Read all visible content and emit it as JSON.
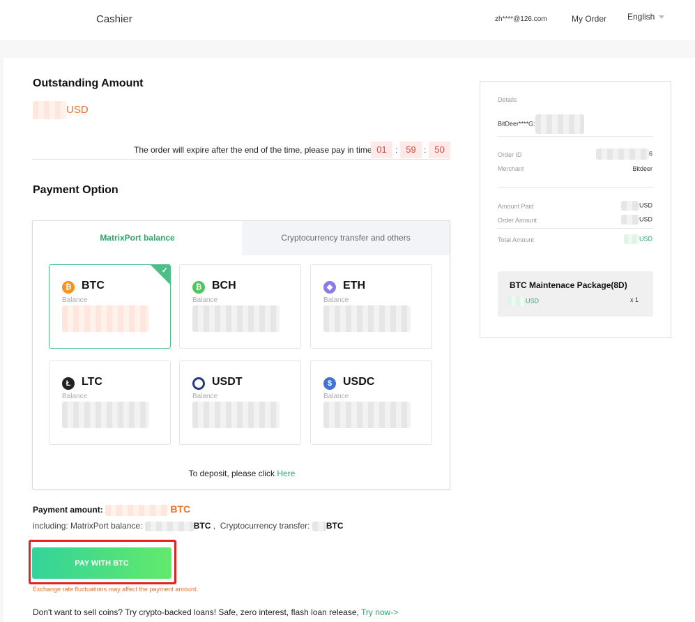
{
  "header": {
    "title": "Cashier",
    "email": "zh****@126.com",
    "my_order": "My Order",
    "language": "English"
  },
  "outstanding": {
    "title": "Outstanding Amount",
    "currency": "USD",
    "expire_text": "The order will expire after the end of the time, please pay in time",
    "timer": {
      "hours": "01",
      "minutes": "59",
      "seconds": "50"
    },
    "separator": ":"
  },
  "payment_option": {
    "title": "Payment Option",
    "tabs": [
      {
        "label": "MatrixPort balance"
      },
      {
        "label": "Cryptocurrency transfer and others"
      }
    ],
    "balance_label": "Balance",
    "coins": [
      {
        "symbol": "BTC",
        "glyph": "₿",
        "color": "#f7931a"
      },
      {
        "symbol": "BCH",
        "glyph": "₿",
        "color": "#4cc65b"
      },
      {
        "symbol": "ETH",
        "glyph": "◆",
        "color": "#8c7ae6"
      },
      {
        "symbol": "LTC",
        "glyph": "Ł",
        "color": "#222222"
      },
      {
        "symbol": "USDT",
        "glyph": "○",
        "color": "#233a7a"
      },
      {
        "symbol": "USDC",
        "glyph": "$",
        "color": "#3f74d4"
      }
    ],
    "deposit_prefix": "To deposit, please click",
    "deposit_link": "Here"
  },
  "payment": {
    "amount_label": "Payment amount:",
    "amount_currency": "BTC",
    "including_label": "including: MatrixPort balance:",
    "balance_currency": "BTC",
    "crypto_label": "Cryptocurrency transfer:",
    "crypto_currency": "BTC",
    "button_label": "PAY WITH BTC",
    "warning": "Exchange rate fluctuations may affect the payment amount.",
    "loan_text": "Don't want to sell coins? Try crypto-backed loans! Safe, zero interest, flash loan release,",
    "loan_link": "Try now->"
  },
  "details": {
    "title": "Details",
    "account": "BitDeer****G:",
    "order_id_label": "Order ID",
    "order_id_end": "6",
    "merchant_label": "Merchant",
    "merchant": "Bitdeer",
    "amount_paid_label": "Amount Paid",
    "order_amount_label": "Order Amount",
    "total_amount_label": "Total Amount",
    "currency": "USD",
    "package": {
      "name": "BTC Maintenace Package(8D)",
      "currency": "USD",
      "qty": "x 1"
    }
  },
  "colors": {
    "accent_green": "#2ea56b",
    "accent_orange": "#e8722a",
    "highlight_red": "#e52020"
  }
}
